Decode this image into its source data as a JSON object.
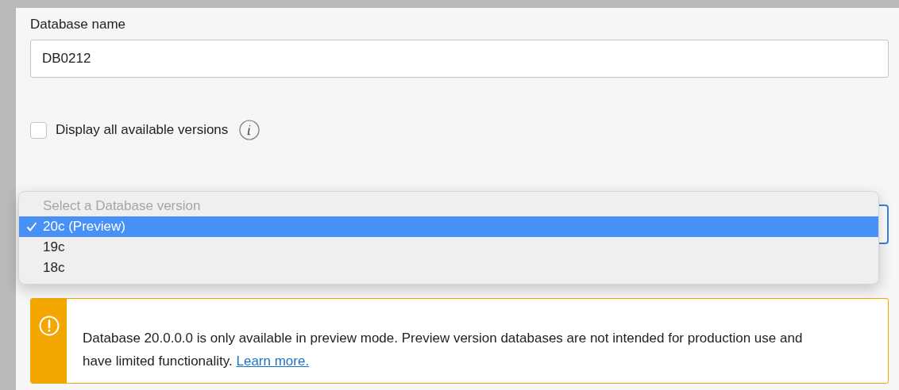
{
  "database_name": {
    "label": "Database name",
    "value": "DB0212"
  },
  "show_all_versions": {
    "label": "Display all available versions",
    "checked": false
  },
  "database_version": {
    "menu": {
      "options": [
        {
          "label": "Select a Database version",
          "disabled": true,
          "selected": false
        },
        {
          "label": "20c (Preview)",
          "disabled": false,
          "selected": true
        },
        {
          "label": "19c",
          "disabled": false,
          "selected": false
        },
        {
          "label": "18c",
          "disabled": false,
          "selected": false
        }
      ]
    }
  },
  "alert": {
    "kind": "warning",
    "text": "Database 20.0.0.0 is only available in preview mode. Preview version databases are not intended for production use and have limited functionality.",
    "link": "Learn more."
  }
}
